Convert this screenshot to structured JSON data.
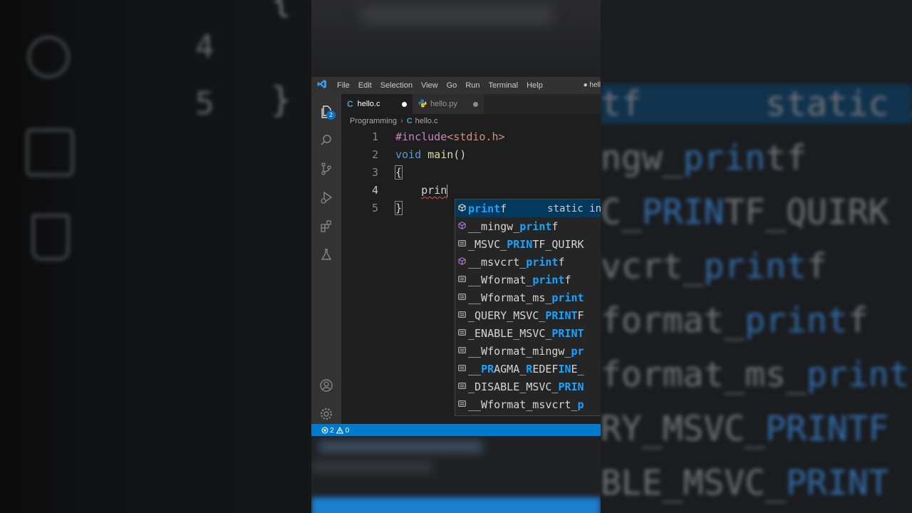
{
  "window": {
    "title_file": "● hell"
  },
  "menu": [
    "File",
    "Edit",
    "Selection",
    "View",
    "Go",
    "Run",
    "Terminal",
    "Help"
  ],
  "activity": {
    "explorer_badge": "2"
  },
  "tabs": [
    {
      "label": "hello.c",
      "icon": "c-file-icon",
      "icon_glyph": "C",
      "modified": true,
      "active": true
    },
    {
      "label": "hello.py",
      "icon": "python-file-icon",
      "modified": true,
      "active": false
    }
  ],
  "breadcrumb": {
    "folder": "Programming",
    "file": "hello.c",
    "file_icon": "C"
  },
  "editor": {
    "line_numbers": [
      "1",
      "2",
      "3",
      "4",
      "5"
    ],
    "line1": {
      "directive": "#include",
      "header": "<stdio.h>"
    },
    "line2": {
      "type": "void",
      "name": "main",
      "rest": "()"
    },
    "line3": "{",
    "line4": {
      "indent": "    ",
      "typed": "prin"
    },
    "line5": "}"
  },
  "suggestions": [
    {
      "pre": "",
      "hl": "print",
      "post": "f",
      "icon": "method",
      "detail": "static in"
    },
    {
      "pre": "__mingw_",
      "hl": "print",
      "post": "f",
      "icon": "method"
    },
    {
      "pre": "_MSVC_",
      "hl": "PRIN",
      "post": "TF_QUIRK",
      "icon": "field"
    },
    {
      "pre": "__msvcrt_",
      "hl": "print",
      "post": "f",
      "icon": "method"
    },
    {
      "pre": "__Wformat_",
      "hl": "print",
      "post": "f",
      "icon": "field"
    },
    {
      "pre": "__Wformat_ms_",
      "hl": "print",
      "post": "",
      "icon": "field"
    },
    {
      "pre": "_QUERY_MSVC_",
      "hl": "PRINT",
      "post": "F",
      "icon": "field"
    },
    {
      "pre": "_ENABLE_MSVC_",
      "hl": "PRINT",
      "post": "",
      "icon": "field"
    },
    {
      "pre": "__Wformat_mingw_",
      "hl": "pr",
      "post": "",
      "icon": "field"
    },
    {
      "pre": "__",
      "hl": "PR",
      "post": "AGMA_",
      "extra_hl": "R",
      "tail": "EDEF",
      "tail_hl": "IN",
      "tail_end": "E_",
      "icon": "field"
    },
    {
      "pre": "_DISABLE_MSVC_",
      "hl": "PRIN",
      "post": "",
      "icon": "field"
    },
    {
      "pre": "__Wformat_msvcrt_",
      "hl": "p",
      "post": "",
      "icon": "field"
    }
  ],
  "status": {
    "errors": "2",
    "warnings": "0"
  },
  "background": {
    "left_numbers": [
      "4",
      "5"
    ],
    "left_braces": [
      "{",
      "}"
    ],
    "right_lines": [
      {
        "pre": "",
        "hl": "",
        "post": "tf      static in"
      },
      {
        "pre": "ngw_",
        "hl": "prin",
        "post": "tf"
      },
      {
        "pre": "C_",
        "hl": "PRIN",
        "post": "TF_QUIRK"
      },
      {
        "pre": "vcrt_",
        "hl": "print",
        "post": "f"
      },
      {
        "pre": "format_",
        "hl": "print",
        "post": "f"
      },
      {
        "pre": "format_ms_",
        "hl": "print",
        "post": ""
      },
      {
        "pre": "RY_MSVC_",
        "hl": "PRINTF",
        "post": ""
      },
      {
        "pre": "BLE_MSVC_",
        "hl": "PRINT",
        "post": ""
      }
    ]
  },
  "colors": {
    "accent": "#007acc",
    "highlight": "#18a3ff",
    "selection": "#04395e",
    "error_squiggle": "#f14c4c"
  }
}
